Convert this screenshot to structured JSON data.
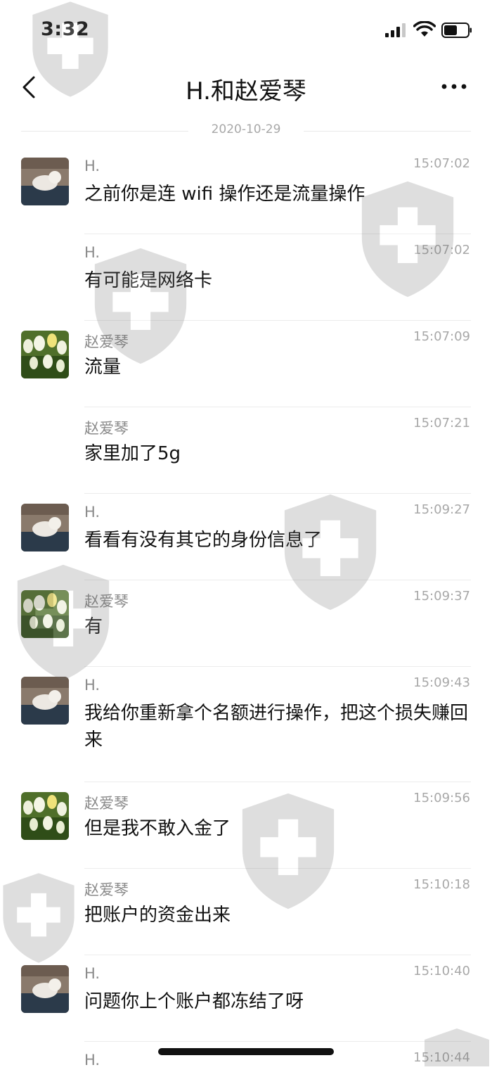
{
  "status_bar": {
    "time": "3:32"
  },
  "nav": {
    "title": "H.和赵爱琴"
  },
  "date_separator": "2020-10-29",
  "messages": [
    {
      "sender": "H.",
      "time": "15:07:02",
      "text": "之前你是连 wifi 操作还是流量操作",
      "avatar": "cat-avatar"
    },
    {
      "sender": "H.",
      "time": "15:07:02",
      "text": "有可能是网络卡",
      "avatar": ""
    },
    {
      "sender": "赵爱琴",
      "time": "15:07:09",
      "text": "流量",
      "avatar": "tulips-avatar"
    },
    {
      "sender": "赵爱琴",
      "time": "15:07:21",
      "text": "家里加了5g",
      "avatar": ""
    },
    {
      "sender": "H.",
      "time": "15:09:27",
      "text": "看看有没有其它的身份信息了",
      "avatar": "cat-avatar"
    },
    {
      "sender": "赵爱琴",
      "time": "15:09:37",
      "text": "有",
      "avatar": "tulips-avatar"
    },
    {
      "sender": "H.",
      "time": "15:09:43",
      "text": "我给你重新拿个名额进行操作，把这个损失赚回来",
      "avatar": "cat-avatar"
    },
    {
      "sender": "赵爱琴",
      "time": "15:09:56",
      "text": "但是我不敢入金了",
      "avatar": "tulips-avatar"
    },
    {
      "sender": "赵爱琴",
      "time": "15:10:18",
      "text": "把账户的资金出来",
      "avatar": ""
    },
    {
      "sender": "H.",
      "time": "15:10:40",
      "text": "问题你上个账户都冻结了呀",
      "avatar": "cat-avatar"
    },
    {
      "sender": "H.",
      "time": "15:10:44",
      "text": "",
      "avatar": ""
    }
  ],
  "colors": {
    "accent": "#111111",
    "secondary_text": "#8a8a8a",
    "divider": "#ececec",
    "watermark": "#6b6b6b"
  }
}
